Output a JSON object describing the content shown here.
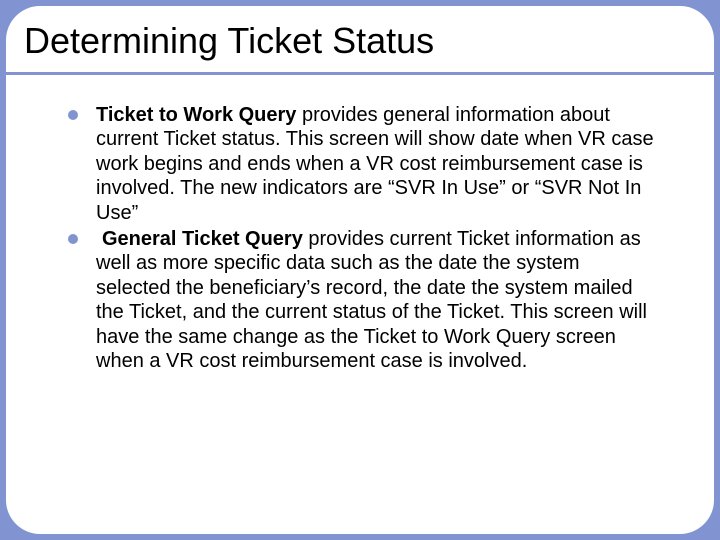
{
  "slide": {
    "title": "Determining Ticket Status",
    "bullets": [
      {
        "bold_lead": "Ticket to Work Query",
        "rest": " provides general information about current Ticket status. This screen will show date when VR case work begins and ends when a VR cost reimbursement case is involved. The new indicators are “SVR In Use” or “SVR Not In Use”"
      },
      {
        "prefix_space": " ",
        "bold_lead": "General Ticket Query",
        "rest": " provides current Ticket information as well as more specific data such as the date the system selected the beneficiary’s record, the date the system mailed the Ticket, and the current status of the Ticket. This screen will have the same change as the Ticket to Work Query screen when a VR cost reimbursement case is involved."
      }
    ]
  }
}
